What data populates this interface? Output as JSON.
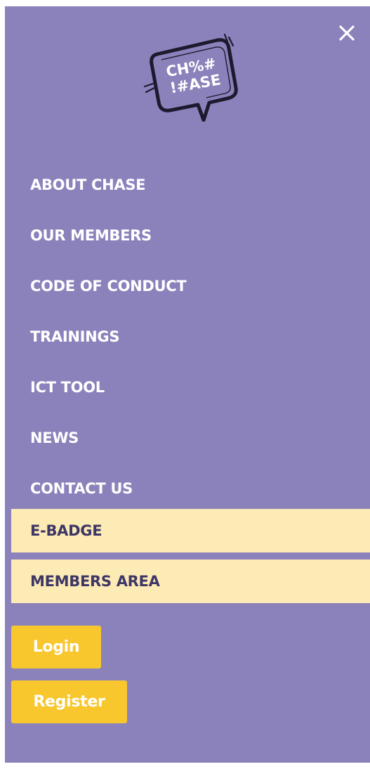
{
  "header": {
    "close_icon": "close-icon",
    "logo": {
      "line1": "CH%#",
      "line2": "!#ASE"
    }
  },
  "nav": {
    "items": [
      {
        "label": "ABOUT CHASE"
      },
      {
        "label": "OUR MEMBERS"
      },
      {
        "label": "CODE OF CONDUCT"
      },
      {
        "label": "TRAININGS"
      },
      {
        "label": "ICT TOOL"
      },
      {
        "label": "NEWS"
      },
      {
        "label": "CONTACT US"
      }
    ],
    "highlighted": [
      {
        "label": "E-BADGE"
      },
      {
        "label": "MEMBERS AREA"
      }
    ]
  },
  "actions": {
    "login_label": "Login",
    "register_label": "Register"
  },
  "colors": {
    "panel_background": "#8b82bb",
    "highlight_background": "#fdebb5",
    "highlight_text": "#3e3766",
    "button_background": "#f8c72e",
    "text": "#ffffff"
  }
}
